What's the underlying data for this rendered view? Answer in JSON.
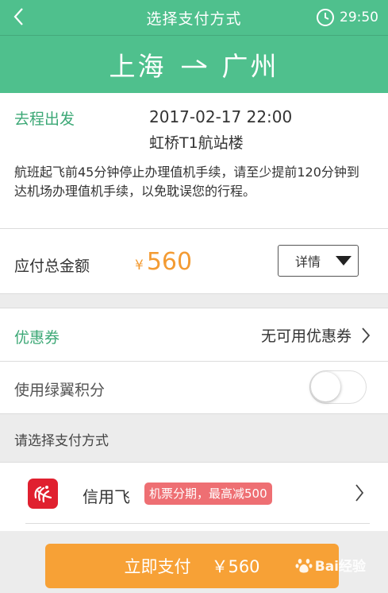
{
  "header": {
    "title": "选择支付方式",
    "timer": "29:50",
    "icons": {
      "back": "chevron-left-icon",
      "timer": "clock-icon"
    }
  },
  "route": {
    "from": "上海",
    "to": "广州"
  },
  "trip": {
    "label": "去程出发",
    "datetime": "2017-02-17 22:00",
    "terminal": "虹桥T1航站楼",
    "notice": "航班起飞前45分钟停止办理值机手续，请至少提前120分钟到达机场办理值机手续，以免耽误您的行程。"
  },
  "amount": {
    "label": "应付总金额",
    "currency": "¥",
    "value": "560",
    "detail_label": "详情"
  },
  "coupon": {
    "label": "优惠券",
    "value": "无可用优惠券"
  },
  "points": {
    "label": "使用绿翼积分",
    "enabled": false
  },
  "payment": {
    "section_title": "请选择支付方式",
    "method_name": "信用飞",
    "promo": "机票分期，最高减500"
  },
  "pay_button": {
    "label": "立即支付",
    "amount": "￥560"
  },
  "watermark": {
    "text": "Bai经验"
  },
  "colors": {
    "brand": "#4fc08d",
    "accent": "#f39b33",
    "pay_button": "#f7a136",
    "promo": "#ee6f73"
  }
}
